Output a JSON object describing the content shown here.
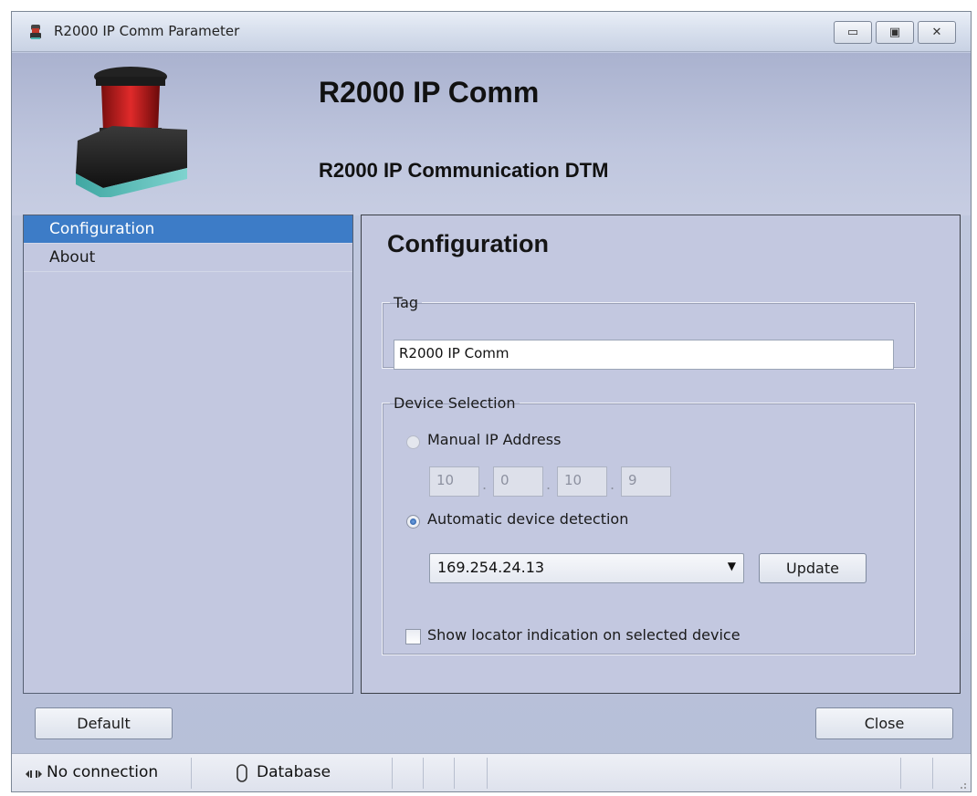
{
  "window": {
    "title": "R2000 IP Comm Parameter",
    "controls": {
      "minimize": "▭",
      "maximize": "▣",
      "close": "✕"
    }
  },
  "header": {
    "title": "R2000 IP Comm",
    "subtitle": "R2000 IP Communication DTM"
  },
  "nav": {
    "items": [
      {
        "label": "Configuration",
        "selected": true
      },
      {
        "label": "About",
        "selected": false
      }
    ]
  },
  "content": {
    "title": "Configuration",
    "tag_group": {
      "legend": "Tag",
      "value": "R2000 IP Comm"
    },
    "device_group": {
      "legend": "Device Selection",
      "manual_label": "Manual IP Address",
      "manual_selected": false,
      "ip": [
        "10",
        "0",
        "10",
        "9"
      ],
      "auto_label": "Automatic device detection",
      "auto_selected": true,
      "device_selected": "169.254.24.13",
      "update_label": "Update",
      "locator_label": "Show locator indication on selected device",
      "locator_checked": false
    }
  },
  "footer": {
    "default_label": "Default",
    "close_label": "Close"
  },
  "status": {
    "connection": "No connection",
    "database": "Database"
  },
  "colors": {
    "accent": "#3d7cc7",
    "panel": "#c3c8e0",
    "header": "#b6bfd8"
  },
  "icons": [
    "device-icon",
    "minimize-icon",
    "maximize-icon",
    "close-icon",
    "dropdown-arrow-icon",
    "connection-icon",
    "database-icon",
    "resize-grip-icon"
  ]
}
